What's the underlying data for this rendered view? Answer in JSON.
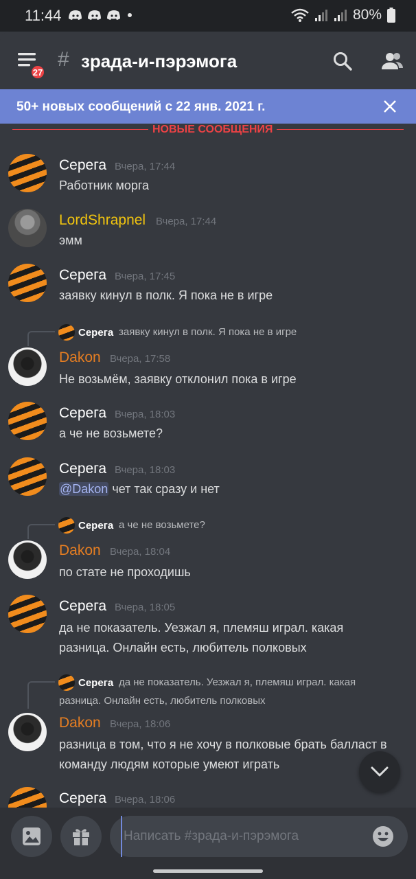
{
  "status_bar": {
    "time": "11:44",
    "battery": "80%"
  },
  "header": {
    "badge_count": "27",
    "hash": "#",
    "channel": "зрада-и-пэрэмога"
  },
  "banner": {
    "text": "50+ новых сообщений с 22 янв. 2021 г."
  },
  "divider": {
    "label": "НОВЫЕ СООБЩЕНИЯ"
  },
  "messages": [
    {
      "author": "Серега",
      "time": "Вчера, 17:44",
      "text": "Работник морга"
    },
    {
      "author": "LordShrapnel",
      "time": "Вчера, 17:44",
      "text": "эмм"
    },
    {
      "author": "Серега",
      "time": "Вчера, 17:45",
      "text": "заявку кинул в полк. Я пока не в игре"
    },
    {
      "reply_author": "Серега",
      "reply_text": "заявку кинул в полк. Я пока не в игре",
      "author": "Dakon",
      "time": "Вчера, 17:58",
      "text": "Не возьмём, заявку отклонил пока в игре"
    },
    {
      "author": "Серега",
      "time": "Вчера, 18:03",
      "text": "а че не возьмете?"
    },
    {
      "author": "Серега",
      "time": "Вчера, 18:03",
      "mention": "@Dakon",
      "text": " чет так сразу и нет"
    },
    {
      "reply_author": "Серега",
      "reply_text": "а че не возьмете?",
      "author": "Dakon",
      "time": "Вчера, 18:04",
      "text": "по стате не проходишь"
    },
    {
      "author": "Серега",
      "time": "Вчера, 18:05",
      "text_line1": "да не показатель. Уезжал я, племяш играл. какая",
      "text_line2": "разница. Онлайн есть, любитель полковых"
    },
    {
      "reply_author": "Серега",
      "reply_line1": "да не показатель. Уезжал я, племяш играл. какая",
      "reply_line2": "разница. Онлайн есть, любитель полковых",
      "author": "Dakon",
      "time": "Вчера, 18:06",
      "text_line1": "разница в том, что я не хочу в полковые брать балласт в",
      "text_line2": "команду людям которые умеют играть"
    },
    {
      "author": "Серега",
      "time": "Вчера, 18:06"
    }
  ],
  "composer": {
    "placeholder": "Написать #зрада-и-пэрэмога"
  },
  "icons": {
    "menu": "hamburger-menu-icon",
    "search": "search-icon",
    "members": "members-icon",
    "close": "close-icon",
    "scroll_down": "chevron-down-icon",
    "gallery": "image-icon",
    "gift": "gift-icon",
    "emoji": "emoji-icon"
  },
  "colors": {
    "background": "#36393f",
    "banner": "#6d83d3",
    "new_divider": "#ed4245",
    "lord_name": "#f1c40f",
    "dakon_name": "#e67e22",
    "mention": "#a5b4f0"
  }
}
